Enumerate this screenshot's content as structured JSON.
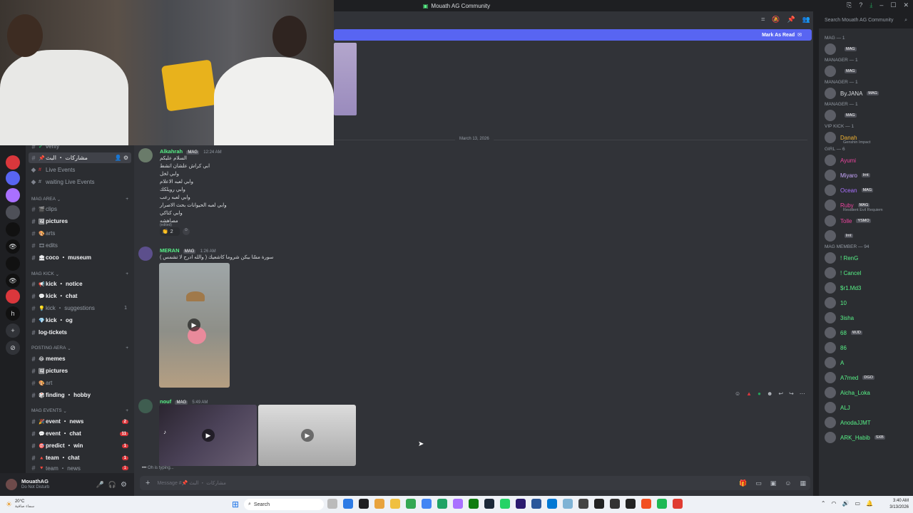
{
  "window": {
    "title": "Mouath AG Community"
  },
  "search": {
    "placeholder": "Search Mouath AG Community"
  },
  "banner": {
    "label": "Mark As Read"
  },
  "date_divider": "March 13, 2026",
  "channels": {
    "top": [
      {
        "label": "verify"
      },
      {
        "label": "مشاركات ・ البث",
        "selected": true
      },
      {
        "label": "Live Events"
      },
      {
        "label": "waiting Live Events"
      }
    ],
    "mag_area": {
      "title": "MAG AREA",
      "items": [
        {
          "label": "clips"
        },
        {
          "label": "pictures",
          "bold": true
        },
        {
          "label": "arts"
        },
        {
          "label": "edits"
        },
        {
          "label": "coco ・ museum",
          "bold": true
        }
      ]
    },
    "mag_kick": {
      "title": "MAG KICK",
      "items": [
        {
          "label": "kick ・ notice",
          "bold": true
        },
        {
          "label": "kick ・ chat",
          "bold": true
        },
        {
          "label": "kick ・ suggestions",
          "num": "1"
        },
        {
          "label": "kick ・ og",
          "bold": true
        },
        {
          "label": "log-tickets",
          "bold": true
        }
      ]
    },
    "posting": {
      "title": "POSTING AERA",
      "items": [
        {
          "label": "memes",
          "bold": true
        },
        {
          "label": "pictures",
          "bold": true
        },
        {
          "label": "art"
        },
        {
          "label": "finding ・ hobby",
          "bold": true
        }
      ]
    },
    "events": {
      "title": "MAG EVENTS",
      "items": [
        {
          "label": "event ・ news",
          "bold": true,
          "cnt": "2"
        },
        {
          "label": "event ・ chat",
          "bold": true,
          "cnt": "11"
        },
        {
          "label": "predict ・ win",
          "bold": true,
          "cnt": "1"
        },
        {
          "label": "team ・ chat",
          "bold": true,
          "cnt": "1"
        },
        {
          "label": "team ・ news",
          "cnt": "1"
        }
      ]
    }
  },
  "user": {
    "name": "MouathAG",
    "status": "Do Not Disturb"
  },
  "messages": {
    "m1": {
      "name": "Alkahrah",
      "tag": "MAG",
      "time": "12:24 AM",
      "lines": [
        "السلام عليكم",
        "ابي كراش علشان اتشط",
        "وابي لخل",
        "وابي لعبه الاعلام",
        "وابي رويلكك",
        "وابي لعبه رعب",
        "وابي لعبه الحيوانات بحث الاصرار",
        "وابي كتاكي",
        "مصاهشه"
      ],
      "edited": "(edited)",
      "reaction": "2"
    },
    "m2": {
      "name": "MERAN",
      "tag": "MAG",
      "time": "1:26 AM",
      "text": "سورة مسّا بيكن شروما كاشعيك ( والله ادرح لا تشمس )"
    },
    "m3": {
      "name": "nouf",
      "tag": "MAG",
      "time": "5:49 AM"
    }
  },
  "typing": "Oh is typing...",
  "composer": {
    "placeholder": "Message #📌 مشاركات ・ البث"
  },
  "members": [
    {
      "head": "MAG — 1"
    },
    {
      "name": "",
      "tag": "MAG",
      "color": "#c27c0e"
    },
    {
      "head": "MANAGER — 1"
    },
    {
      "name": "",
      "tag": "MAG",
      "color": "#eb459e"
    },
    {
      "head": "MANAGER — 1"
    },
    {
      "name": "By.JANA",
      "tag": "MAG",
      "color": "#dbdee1"
    },
    {
      "head": "MANAGER — 1"
    },
    {
      "name": "",
      "tag": "MAG",
      "color": "#dbdee1"
    },
    {
      "head": "VIP kick — 1"
    },
    {
      "name": "Danah",
      "sub": "Genshin Impact",
      "color": "#f0b232"
    },
    {
      "head": "girl — 6"
    },
    {
      "name": "Ayumi",
      "color": "#eb459e"
    },
    {
      "name": "Miyaro",
      "tag": "lrnt",
      "color": "#c9a7ff"
    },
    {
      "name": "Ocean",
      "tag": "MAG",
      "color": "#a970ff"
    },
    {
      "name": "Ruby",
      "tag": "MAG",
      "sub": "Resident Evil Requiem",
      "color": "#eb459e"
    },
    {
      "name": "Tolle",
      "tag": "YSMO",
      "color": "#eb459e"
    },
    {
      "name": "",
      "tag": "lrnt",
      "color": "#eb459e"
    },
    {
      "head": "MAG member — 94"
    },
    {
      "name": "! RenG",
      "color": "#57f287"
    },
    {
      "name": "! Cancel",
      "color": "#57f287"
    },
    {
      "name": "$r1.Md3",
      "color": "#57f287"
    },
    {
      "name": "10",
      "color": "#57f287"
    },
    {
      "name": "3isha",
      "color": "#57f287"
    },
    {
      "name": "68",
      "tag": "WJD",
      "color": "#57f287"
    },
    {
      "name": "86",
      "color": "#57f287"
    },
    {
      "name": "A",
      "color": "#57f287"
    },
    {
      "name": "A7med",
      "tag": "DGO",
      "color": "#57f287"
    },
    {
      "name": "Aicha_Loka",
      "color": "#57f287"
    },
    {
      "name": "ALJ",
      "color": "#57f287"
    },
    {
      "name": "AnodaJJMT",
      "color": "#57f287"
    },
    {
      "name": "ARK_Habib",
      "tag": "SXB",
      "color": "#57f287"
    }
  ],
  "taskbar": {
    "search": "Search",
    "weather_temp": "20°C",
    "weather_text": "سماء صافية",
    "time": "3:40 AM",
    "date": "3/13/2026"
  }
}
